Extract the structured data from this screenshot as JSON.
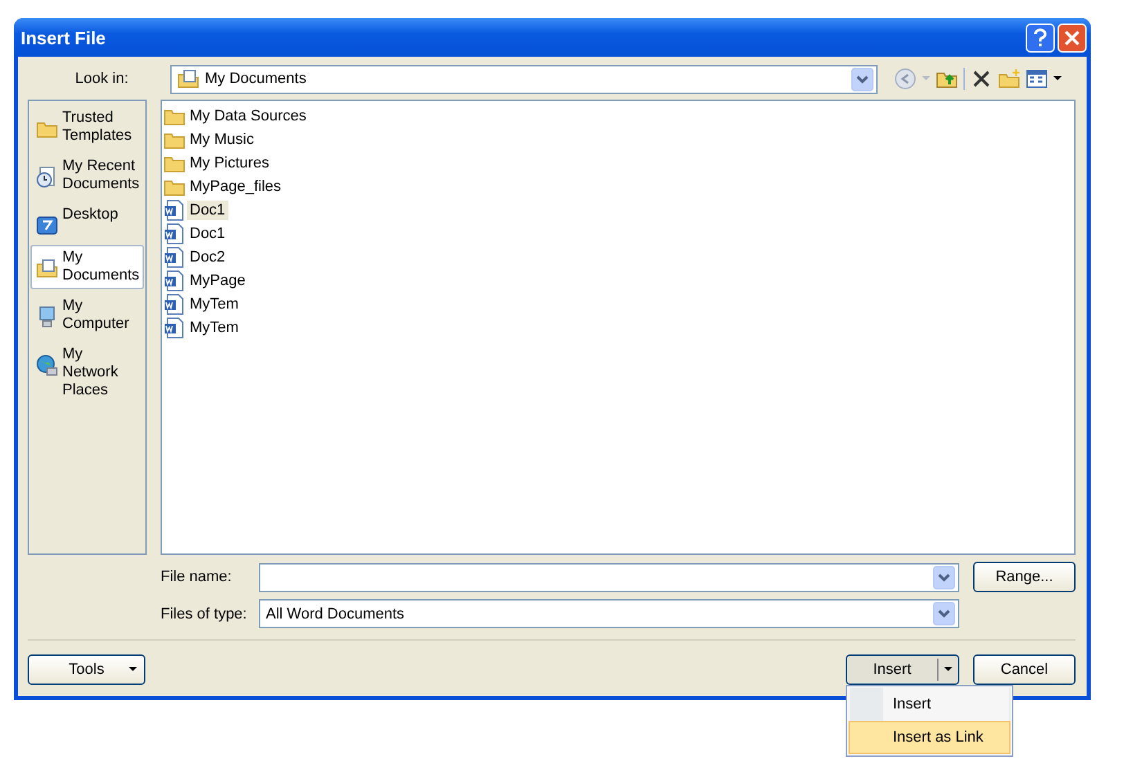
{
  "window": {
    "title": "Insert File"
  },
  "look_in": {
    "label": "Look in:",
    "value": "My Documents"
  },
  "places": [
    {
      "label": "Trusted Templates",
      "kind": "folder",
      "selected": false
    },
    {
      "label": "My Recent Documents",
      "kind": "recent",
      "selected": false
    },
    {
      "label": "Desktop",
      "kind": "desktop",
      "selected": false
    },
    {
      "label": "My Documents",
      "kind": "documents",
      "selected": true
    },
    {
      "label": "My Computer",
      "kind": "computer",
      "selected": false
    },
    {
      "label": "My Network Places",
      "kind": "network",
      "selected": false
    }
  ],
  "files": [
    {
      "name": "My Data Sources",
      "kind": "folder",
      "selected": false
    },
    {
      "name": "My Music",
      "kind": "folder",
      "selected": false
    },
    {
      "name": "My Pictures",
      "kind": "folder",
      "selected": false
    },
    {
      "name": "MyPage_files",
      "kind": "folder",
      "selected": false
    },
    {
      "name": "Doc1",
      "kind": "doc",
      "selected": true
    },
    {
      "name": "Doc1",
      "kind": "doc",
      "selected": false
    },
    {
      "name": "Doc2",
      "kind": "doc",
      "selected": false
    },
    {
      "name": "MyPage",
      "kind": "doc",
      "selected": false
    },
    {
      "name": "MyTem",
      "kind": "doc",
      "selected": false
    },
    {
      "name": "MyTem",
      "kind": "doc",
      "selected": false
    }
  ],
  "file_name": {
    "label": "File name:"
  },
  "files_of_type": {
    "label": "Files of type:",
    "value": "All Word Documents"
  },
  "range_button": "Range...",
  "tools_button": "Tools",
  "insert_button": "Insert",
  "cancel_button": "Cancel",
  "insert_menu": [
    {
      "label": "Insert",
      "selected": false
    },
    {
      "label": "Insert as Link",
      "selected": true
    }
  ]
}
